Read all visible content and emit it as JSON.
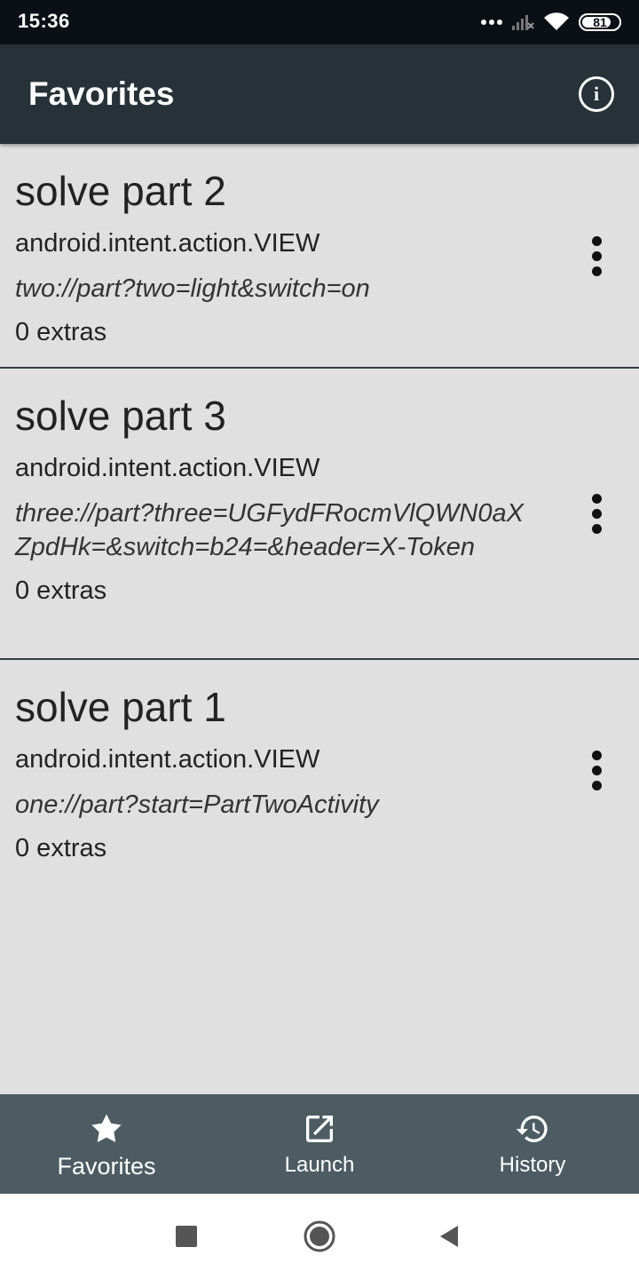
{
  "status_bar": {
    "time": "15:36",
    "battery": "81",
    "battery_level": 0.81
  },
  "app_bar": {
    "title": "Favorites",
    "info_icon": "info-icon"
  },
  "favorites": [
    {
      "title": "solve part 2",
      "action": "android.intent.action.VIEW",
      "uri": "two://part?two=light&switch=on",
      "extras": "0 extras"
    },
    {
      "title": "solve part 3",
      "action": "android.intent.action.VIEW",
      "uri": "three://part?three=UGFydFRocmVlQWN0aXZpdHk=&switch=b24=&header=X-Token",
      "extras": "0 extras"
    },
    {
      "title": "solve part 1",
      "action": "android.intent.action.VIEW",
      "uri": "one://part?start=PartTwoActivity",
      "extras": "0 extras"
    }
  ],
  "bottom_nav": {
    "items": [
      {
        "label": "Favorites",
        "icon": "star-icon",
        "active": true
      },
      {
        "label": "Launch",
        "icon": "open-in-new-icon",
        "active": false
      },
      {
        "label": "History",
        "icon": "history-icon",
        "active": false
      }
    ]
  },
  "system_nav": {
    "recents_icon": "recents-icon",
    "home_icon": "home-icon",
    "back_icon": "back-icon"
  },
  "colors": {
    "app_bar": "#263238",
    "list_background": "#e0e0e0",
    "bottom_nav": "#4d5c63",
    "status_bar": "#0a1016"
  }
}
